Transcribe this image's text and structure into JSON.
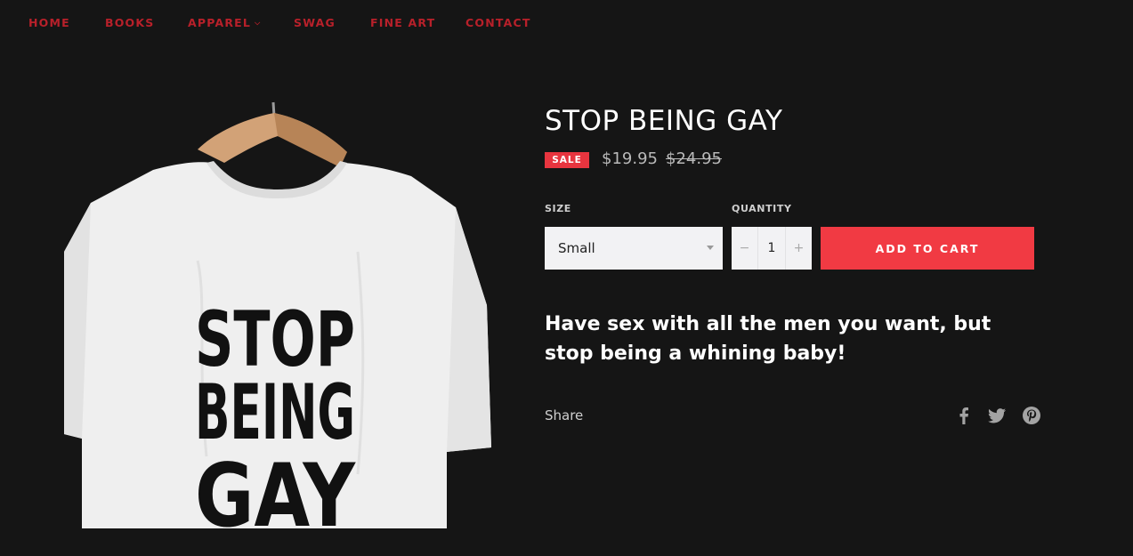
{
  "nav": {
    "items": [
      {
        "label": "HOME"
      },
      {
        "label": "BOOKS"
      },
      {
        "label": "APPAREL",
        "has_dropdown": true
      },
      {
        "label": "SWAG"
      },
      {
        "label": "FINE ART"
      },
      {
        "label": "CONTACT"
      }
    ]
  },
  "product": {
    "title": "STOP BEING GAY",
    "sale_badge": "SALE",
    "price": "$19.95",
    "compare_price": "$24.95",
    "shirt_text": [
      "STOP",
      "BEING",
      "GAY"
    ],
    "size_label": "SIZE",
    "size_selected": "Small",
    "quantity_label": "QUANTITY",
    "quantity": "1",
    "qty_minus": "−",
    "qty_plus": "+",
    "add_to_cart": "ADD TO CART",
    "description": "Have sex with all the men you want, but stop being a whining baby!"
  },
  "share": {
    "label": "Share",
    "icons": [
      "facebook-icon",
      "twitter-icon",
      "pinterest-icon"
    ]
  },
  "colors": {
    "background": "#151515",
    "nav_text": "#b8202a",
    "accent": "#f13a43",
    "sale_badge": "#e8353f"
  }
}
